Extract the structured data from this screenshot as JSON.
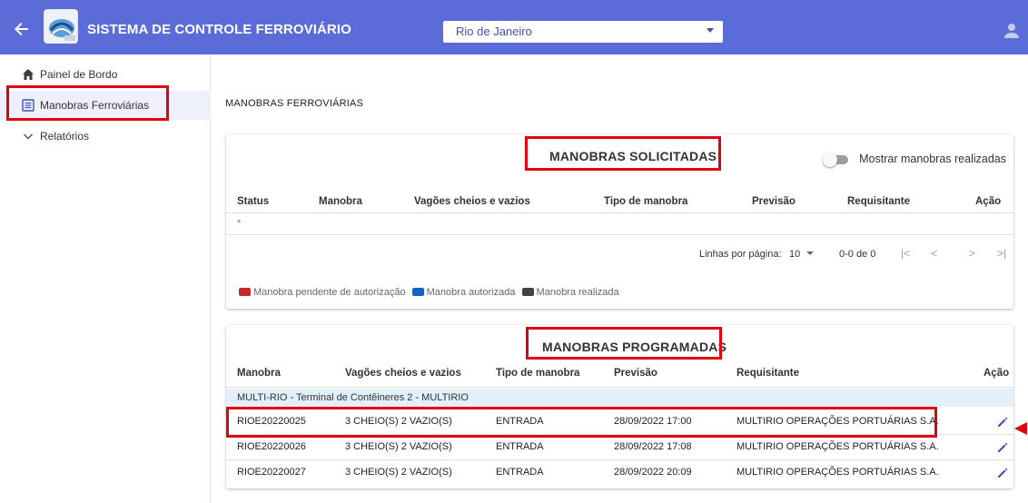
{
  "header": {
    "title": "SISTEMA DE CONTROLE FERROVIÁRIO",
    "city": "Rio de Janeiro",
    "accent": "#5b6cd8"
  },
  "sidebar": {
    "items": [
      {
        "label": "Painel de Bordo",
        "icon": "home-icon"
      },
      {
        "label": "Manobras Ferroviárias",
        "icon": "list-icon"
      },
      {
        "label": "Relatórios",
        "icon": "chevron-down-icon"
      }
    ]
  },
  "main": {
    "page_title": "MANOBRAS FERROVIÁRIAS"
  },
  "solicitadas": {
    "title": "MANOBRAS SOLICITADAS",
    "toggle_label": "Mostrar manobras realizadas",
    "columns": [
      "Status",
      "Manobra",
      "Vagões cheios e vazios",
      "Tipo de manobra",
      "Previsão",
      "Requisitante",
      "Ação"
    ],
    "empty_marker": "*",
    "pager": {
      "rows_label": "Linhas por página:",
      "rows_value": "10",
      "range": "0-0 de 0"
    },
    "legend": [
      {
        "label": "Manobra pendente de autorização",
        "color": "#c62828"
      },
      {
        "label": "Manobra autorizada",
        "color": "#1565c0"
      },
      {
        "label": "Manobra realizada",
        "color": "#424242"
      }
    ]
  },
  "programadas": {
    "title": "MANOBRAS PROGRAMADAS",
    "columns": [
      "Manobra",
      "Vagões cheios e vazios",
      "Tipo de manobra",
      "Previsão",
      "Requisitante",
      "Ação"
    ],
    "group": "MULTI-RIO - Terminal de Contêineres 2 - MULTIRIO",
    "rows": [
      {
        "manobra": "RIOE20220025",
        "vagoes": "3 CHEIO(S) 2 VAZIO(S)",
        "tipo": "ENTRADA",
        "previsao": "28/09/2022 17:00",
        "requisitante": "MULTIRIO OPERAÇÕES PORTUÁRIAS S.A."
      },
      {
        "manobra": "RIOE20220026",
        "vagoes": "3 CHEIO(S) 2 VAZIO(S)",
        "tipo": "ENTRADA",
        "previsao": "28/09/2022 17:08",
        "requisitante": "MULTIRIO OPERAÇÕES PORTUÁRIAS S.A."
      },
      {
        "manobra": "RIOE20220027",
        "vagoes": "3 CHEIO(S) 2 VAZIO(S)",
        "tipo": "ENTRADA",
        "previsao": "28/09/2022 20:09",
        "requisitante": "MULTIRIO OPERAÇÕES PORTUÁRIAS S.A."
      }
    ]
  }
}
